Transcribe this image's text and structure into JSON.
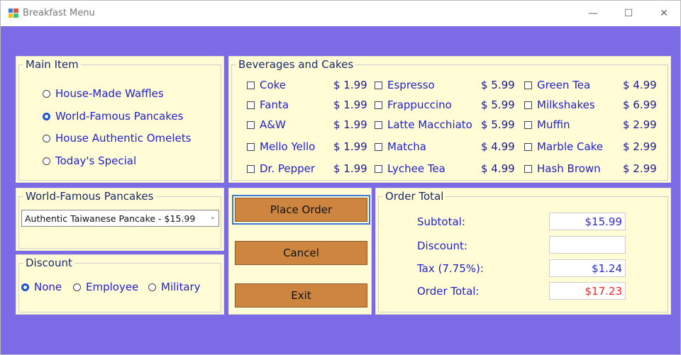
{
  "window": {
    "title": "Breakfast Menu",
    "controls": {
      "minimize": "—",
      "maximize": "☐",
      "close": "✕"
    }
  },
  "colors": {
    "background": "#7b6be6",
    "panel": "#fffcd6",
    "button": "#cd853f",
    "text_blue": "#1f1fd0",
    "total_red": "#ff2020"
  },
  "main_item": {
    "legend": "Main Item",
    "options": [
      {
        "label": "House-Made Waffles",
        "selected": false
      },
      {
        "label": "World-Famous Pancakes",
        "selected": true
      },
      {
        "label": "House Authentic Omelets",
        "selected": false
      },
      {
        "label": "Today's Special",
        "selected": false
      }
    ]
  },
  "beverages": {
    "legend": "Beverages and Cakes",
    "items": [
      {
        "label": "Coke",
        "price": "$ 1.99",
        "checked": false
      },
      {
        "label": "Fanta",
        "price": "$ 1.99",
        "checked": false
      },
      {
        "label": "A&W",
        "price": "$ 1.99",
        "checked": false
      },
      {
        "label": "Mello Yello",
        "price": "$ 1.99",
        "checked": false
      },
      {
        "label": "Dr. Pepper",
        "price": "$ 1.99",
        "checked": false
      },
      {
        "label": "Espresso",
        "price": "$ 5.99",
        "checked": false
      },
      {
        "label": "Frappuccino",
        "price": "$ 5.99",
        "checked": false
      },
      {
        "label": "Latte Macchiato",
        "price": "$ 5.99",
        "checked": false
      },
      {
        "label": "Matcha",
        "price": "$ 4.99",
        "checked": false
      },
      {
        "label": "Lychee Tea",
        "price": "$ 4.99",
        "checked": false
      },
      {
        "label": "Green Tea",
        "price": "$ 4.99",
        "checked": false
      },
      {
        "label": "Milkshakes",
        "price": "$ 6.99",
        "checked": false
      },
      {
        "label": "Muffin",
        "price": "$ 2.99",
        "checked": false
      },
      {
        "label": "Marble Cake",
        "price": "$ 2.99",
        "checked": false
      },
      {
        "label": "Hash Brown",
        "price": "$ 2.99",
        "checked": false
      }
    ]
  },
  "pancakes": {
    "legend": "World-Famous Pancakes",
    "selected": "Authentic Taiwanese Pancake - $15.99"
  },
  "discount": {
    "legend": "Discount",
    "options": [
      {
        "label": "None",
        "selected": true
      },
      {
        "label": "Employee",
        "selected": false
      },
      {
        "label": "Military",
        "selected": false
      }
    ]
  },
  "buttons": {
    "place_order": "Place Order",
    "cancel": "Cancel",
    "exit": "Exit"
  },
  "order_total": {
    "legend": "Order Total",
    "subtotal_label": "Subtotal:",
    "subtotal_value": "$15.99",
    "discount_label": "Discount:",
    "discount_value": "",
    "tax_label": "Tax (7.75%):",
    "tax_value": "$1.24",
    "total_label": "Order Total:",
    "total_value": "$17.23"
  }
}
